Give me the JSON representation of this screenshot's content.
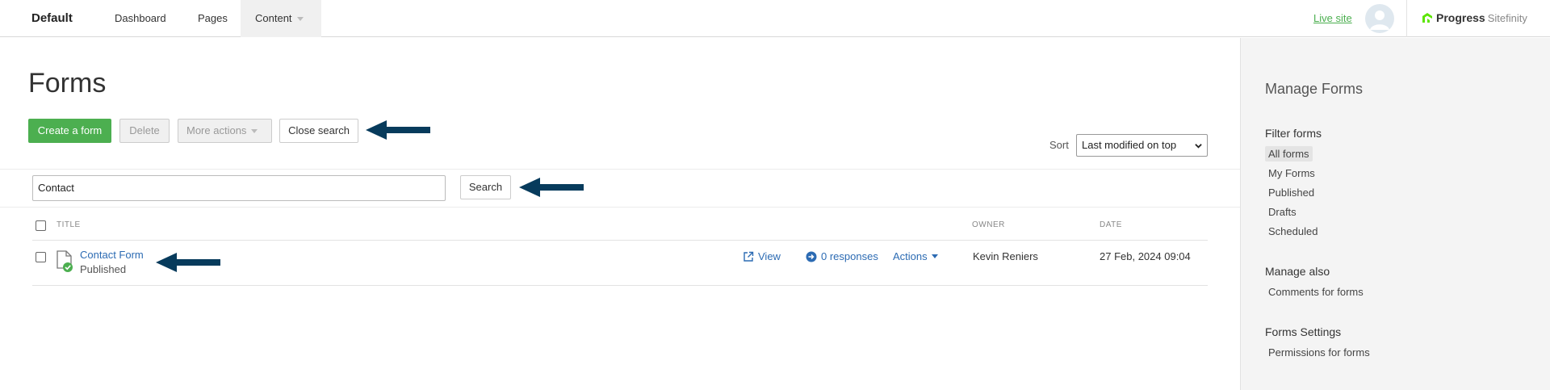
{
  "topbar": {
    "brand": "Default",
    "nav": [
      {
        "label": "Dashboard"
      },
      {
        "label": "Pages"
      },
      {
        "label": "Content"
      }
    ],
    "live_site": "Live site",
    "logo": {
      "progress": "Progress",
      "sitefinity": "Sitefinity"
    }
  },
  "main": {
    "title": "Forms",
    "toolbar": {
      "create_label": "Create a form",
      "delete_label": "Delete",
      "more_actions_label": "More actions",
      "close_search_label": "Close search"
    },
    "sort": {
      "label": "Sort",
      "selected": "Last modified on top"
    },
    "search": {
      "value": "Contact",
      "button_label": "Search"
    },
    "table": {
      "headers": {
        "title": "TITLE",
        "owner": "OWNER",
        "date": "DATE"
      },
      "rows": [
        {
          "title": "Contact Form",
          "status": "Published",
          "view_label": "View",
          "responses_label": "0 responses",
          "actions_label": "Actions",
          "owner": "Kevin Reniers",
          "date": "27 Feb, 2024 09:04"
        }
      ]
    }
  },
  "sidebar": {
    "title": "Manage Forms",
    "filter_heading": "Filter forms",
    "filters": [
      {
        "label": "All forms"
      },
      {
        "label": "My Forms"
      },
      {
        "label": "Published"
      },
      {
        "label": "Drafts"
      },
      {
        "label": "Scheduled"
      }
    ],
    "manage_heading": "Manage also",
    "manage_items": [
      {
        "label": "Comments for forms"
      }
    ],
    "settings_heading": "Forms Settings",
    "settings_items": [
      {
        "label": "Permissions for forms"
      }
    ]
  },
  "colors": {
    "primary_green": "#4caf50",
    "link_blue": "#2c6bb3",
    "arrow_navy": "#073b5c"
  }
}
